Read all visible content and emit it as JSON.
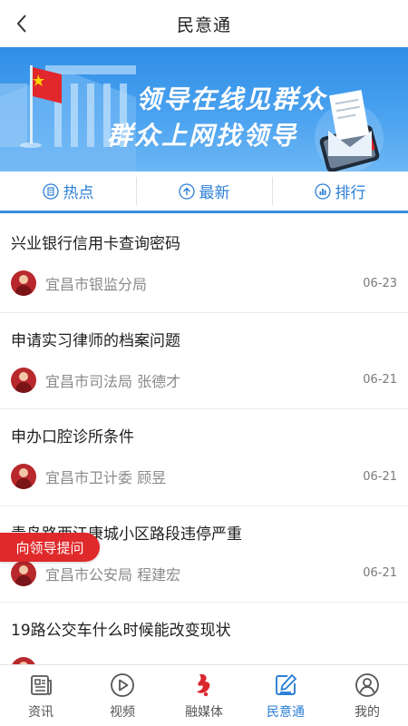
{
  "header": {
    "title": "民意通"
  },
  "banner": {
    "line1": "领导在线见群众",
    "line2": "群众上网找领导"
  },
  "tabs": [
    {
      "label": "热点",
      "icon": "document-icon"
    },
    {
      "label": "最新",
      "icon": "arrow-up-circle-icon"
    },
    {
      "label": "排行",
      "icon": "bar-chart-icon"
    }
  ],
  "items": [
    {
      "title": "兴业银行信用卡查询密码",
      "dept": "宜昌市银监分局",
      "date": "06-23"
    },
    {
      "title": "申请实习律师的档案问题",
      "dept": "宜昌市司法局 张德才",
      "date": "06-21"
    },
    {
      "title": "申办口腔诊所条件",
      "dept": "宜昌市卫计委 顾昱",
      "date": "06-21"
    },
    {
      "title": "青岛路西江康城小区路段违停严重",
      "dept": "宜昌市公安局 程建宏",
      "date": "06-21"
    },
    {
      "title": "19路公交车什么时候能改变现状",
      "dept": "",
      "date": ""
    }
  ],
  "ask_button": "向领导提问",
  "nav": [
    {
      "label": "资讯",
      "icon": "news-icon"
    },
    {
      "label": "视频",
      "icon": "play-icon"
    },
    {
      "label": "融媒体",
      "icon": "media-logo-icon"
    },
    {
      "label": "民意通",
      "icon": "edit-icon",
      "active": true
    },
    {
      "label": "我的",
      "icon": "user-icon"
    }
  ],
  "colors": {
    "accent": "#2b7fd6",
    "banner": "#3a96ea",
    "red": "#e0292b"
  }
}
